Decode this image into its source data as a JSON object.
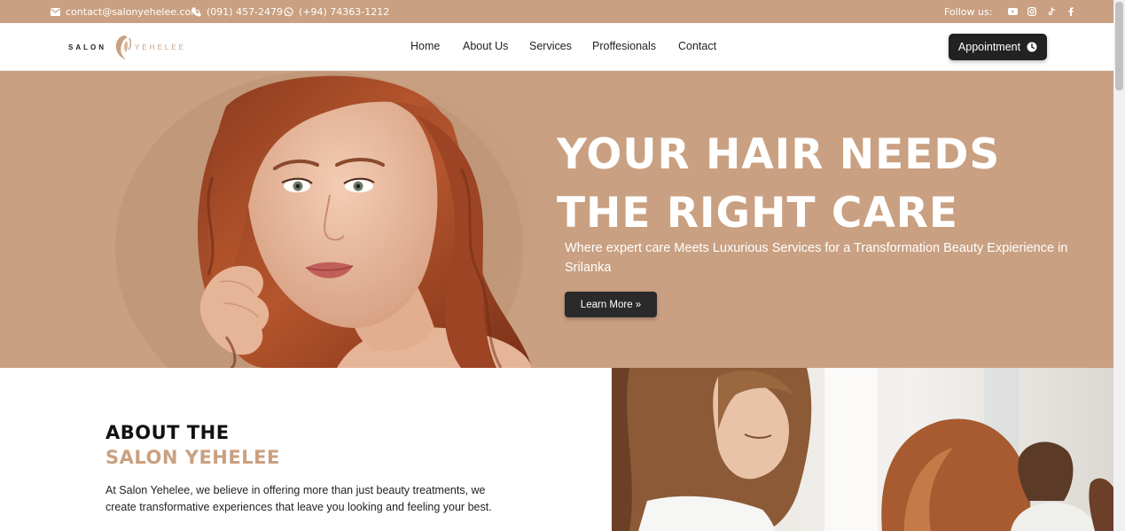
{
  "topbar": {
    "email": "contact@salonyehelee.com",
    "phone": "(091) 457-2479",
    "whatsapp": "(+94) 74363-1212",
    "follow_label": "Follow us:",
    "social_icons": [
      "youtube-icon",
      "instagram-icon",
      "tiktok-icon",
      "facebook-icon"
    ]
  },
  "brand": {
    "left": "SALON",
    "right": "YEHELEE",
    "accent_color": "#c9a081",
    "dark_color": "#222222"
  },
  "nav": {
    "items": [
      {
        "label": "Home"
      },
      {
        "label": "About Us"
      },
      {
        "label": "Services"
      },
      {
        "label": "Proffesionals"
      },
      {
        "label": "Contact"
      }
    ],
    "appointment_label": "Appointment"
  },
  "hero": {
    "title_line1": "YOUR HAIR NEEDS",
    "title_line2": "THE RIGHT CARE",
    "subtitle": "Where expert care Meets Luxurious Services for a Transformation Beauty Expierience in Srilanka",
    "button_label": "Learn More »"
  },
  "about": {
    "heading_line1": "ABOUT THE",
    "heading_line2": "SALON YEHELEE",
    "text": "At Salon Yehelee, we believe in offering more than just beauty treatments, we create transformative experiences that leave you looking and feeling your best."
  }
}
